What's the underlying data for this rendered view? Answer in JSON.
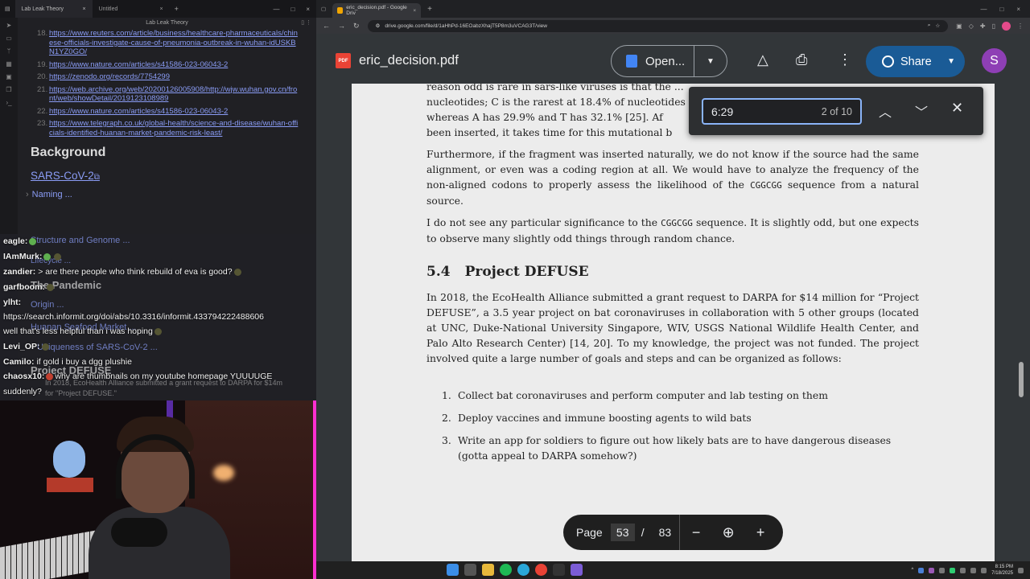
{
  "notes_app": {
    "tabs": [
      {
        "label": "Lab Leak Theory",
        "close": "×"
      },
      {
        "label": "Untitled",
        "close": "×"
      }
    ],
    "new_tab": "+",
    "window_controls": {
      "min": "—",
      "max": "□",
      "close": "×"
    },
    "note_title": "Lab Leak Theory",
    "references": [
      {
        "num": "18.",
        "url": "https://www.reuters.com/article/business/healthcare-pharmaceuticals/chinese-officials-investigate-cause-of-pneumonia-outbreak-in-wuhan-idUSKBN1YZ0GO/"
      },
      {
        "num": "19.",
        "url": "https://www.nature.com/articles/s41586-023-06043-2"
      },
      {
        "num": "20.",
        "url": "https://zenodo.org/records/7754299"
      },
      {
        "num": "21.",
        "url": "https://web.archive.org/web/20200126005908/http://wjw.wuhan.gov.cn/front/web/showDetail/2019123108989"
      },
      {
        "num": "22.",
        "url": "https://www.nature.com/articles/s41586-023-06043-2"
      },
      {
        "num": "23.",
        "url": "https://www.telegraph.co.uk/global-health/science-and-disease/wuhan-officials-identified-huanan-market-pandemic-risk-least/"
      }
    ],
    "heading_background": "Background",
    "link_sars": "SARS-CoV-2",
    "external_link_glyph": "⧉",
    "outline": {
      "naming": "Naming ...",
      "structure": "Structure and Genome ...",
      "lifecycle": "Lifecycle ...",
      "pandemic": "The Pandemic",
      "origin": "Origin ...",
      "market": "Huanan Seafood Market ...",
      "uniqueness": "Uniqueness of SARS-CoV-2 ...",
      "defuse": "Project DEFUSE",
      "defuse_caption": "In 2018, EcoHealth Alliance submitted a grant request to DARPA for $14m for \"Project DEFUSE.\""
    }
  },
  "chat": [
    {
      "user": "eagle:",
      "text": ""
    },
    {
      "user": "IAmMurk:",
      "text": ""
    },
    {
      "user": "zandier:",
      "text": "> are there people who think rebuild of eva is good?"
    },
    {
      "user": "garfboom:",
      "text": ""
    },
    {
      "user": "ylht:",
      "text": ""
    },
    {
      "user": "",
      "text": "https://search.informit.org/doi/abs/10.3316/informit.433794222488606"
    },
    {
      "user": "",
      "text": "well that's less helpful than i was hoping"
    },
    {
      "user": "Levi_OP:",
      "text": ""
    },
    {
      "user": "Camilo:",
      "text": "if gold   i buy a dgg plushie"
    },
    {
      "user": "chaosx10:",
      "text": "why are thumbnails on my youtube homepage YUUUUGE"
    },
    {
      "user": "",
      "text": "suddenly?"
    }
  ],
  "browser": {
    "tabs": [
      {
        "label": "eric_decision.pdf - Google Driv",
        "close": "×"
      }
    ],
    "new_tab": "+",
    "url": "drive.google.com/file/d/1aHhPd-16EOabzXhajT5P8m3uVCAG3T/view",
    "nav": {
      "back": "←",
      "forward": "→",
      "reload": "↻"
    },
    "window_controls": {
      "min": "—",
      "max": "□",
      "close": "×"
    },
    "file_name": "eric_decision.pdf",
    "pdf_badge": "PDF",
    "open_with": "Open...",
    "share": "Share",
    "avatar_letter": "S",
    "find": {
      "query": "6:29",
      "count": "2 of 10"
    },
    "page_control": {
      "label": "Page",
      "current": "53",
      "separator": "/",
      "total": "83",
      "zoom_out": "−",
      "zoom_in": "+"
    }
  },
  "pdf": {
    "para_top": [
      "reason odd is rare in sars-like viruses is that the ...",
      "nucleotides; C is the rarest at 18.4% of nucleotides",
      "whereas A has 29.9% and T has 32.1% [25]. Af",
      "been inserted, it takes time for this mutational b"
    ],
    "para2": "Furthermore, if the fragment was inserted naturally, we do not know if the source had the same alignment, or even was a coding region at all. We would have to analyze the frequency of the non-aligned codons to properly assess the likelihood of the",
    "para2_code": "CGGCGG",
    "para2_end": "sequence from a natural source.",
    "para3_start": "I do not see any particular significance to the",
    "para3_code": "CGGCGG",
    "para3_end": "sequence. It is slightly odd, but one expects to observe many slightly odd things through random chance.",
    "section_number": "5.4",
    "section_title": "Project DEFUSE",
    "para4": "In 2018, the EcoHealth Alliance submitted a grant request to DARPA for $14 million for “Project DEFUSE”, a 3.5 year project on bat coronaviruses in collaboration with 5 other groups (located at UNC, Duke-National University Singapore, WIV, USGS National Wildlife Health Center, and Palo Alto Research Center) [14, 20]. To my knowledge, the project was not funded. The project involved quite a large number of goals and steps and can be organized as follows:",
    "list": [
      {
        "n": "1.",
        "text": "Collect bat coronaviruses and perform computer and lab testing on them"
      },
      {
        "n": "2.",
        "text": "Deploy vaccines and immune boosting agents to wild bats"
      },
      {
        "n": "3.",
        "text": "Write an app for soldiers to figure out how likely bats are to have dangerous diseases (gotta appeal to DARPA somehow?)"
      }
    ]
  },
  "taskbar": {
    "time": "8:15 PM",
    "date": "7/18/2025"
  }
}
